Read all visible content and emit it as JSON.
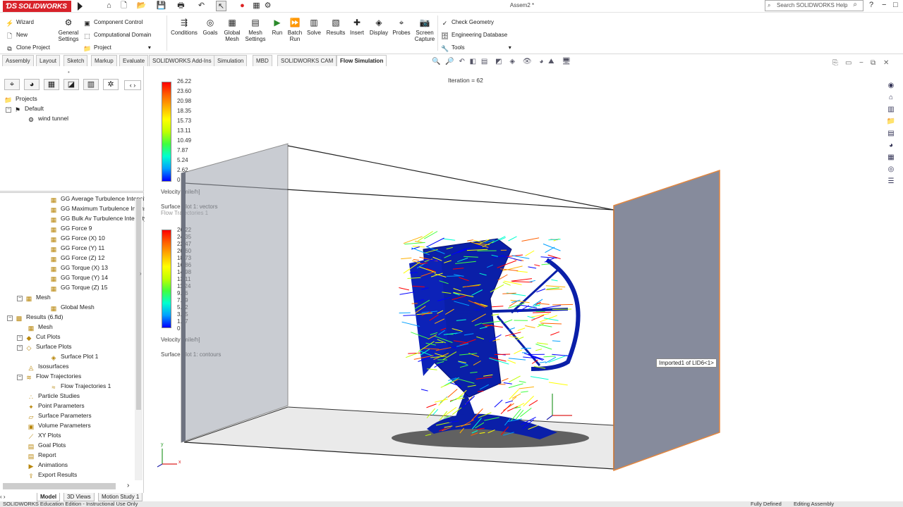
{
  "app": {
    "name": "SOLIDWORKS",
    "doc_title": "Assem2 *"
  },
  "search": {
    "placeholder": "Search SOLIDWORKS Help"
  },
  "ribbon": {
    "col1": [
      "Wizard",
      "New",
      "Clone Project"
    ],
    "general_settings": "General Settings",
    "col3": [
      "Component Control",
      "Computational Domain",
      "Project"
    ],
    "big": [
      "Conditions",
      "Goals",
      "Global Mesh",
      "Mesh Settings",
      "Run",
      "Batch Run",
      "Solve",
      "Results",
      "Insert",
      "Display",
      "Probes",
      "Screen Capture"
    ],
    "col_right": [
      "Check Geometry",
      "Engineering Database",
      "Tools"
    ]
  },
  "tabs": [
    "Assembly",
    "Layout",
    "Sketch",
    "Markup",
    "Evaluate",
    "SOLIDWORKS Add-Ins",
    "Simulation",
    "MBD",
    "SOLIDWORKS CAM",
    "Flow Simulation"
  ],
  "active_tab": "Flow Simulation",
  "tree_top": {
    "projects": "Projects",
    "default": "Default",
    "wind_tunnel": "wind tunnel"
  },
  "tree": [
    "GG Average Turbulence Intensity",
    "GG Maximum Turbulence Intens",
    "GG Bulk Av Turbulence Intensity",
    "GG Force 9",
    "GG Force (X) 10",
    "GG Force (Y) 11",
    "GG Force (Z) 12",
    "GG Torque (X) 13",
    "GG Torque (Y) 14",
    "GG Torque (Z) 15",
    "Mesh",
    "Global Mesh",
    "Results (6.fld)",
    "Mesh",
    "Cut Plots",
    "Surface Plots",
    "Surface Plot 1",
    "Isosurfaces",
    "Flow Trajectories",
    "Flow Trajectories 1",
    "Particle Studies",
    "Point Parameters",
    "Surface Parameters",
    "Volume Parameters",
    "XY Plots",
    "Goal Plots",
    "Report",
    "Animations",
    "Export Results"
  ],
  "bottom_tabs": [
    "Model",
    "3D Views",
    "Motion Study 1"
  ],
  "status": {
    "left": "SOLIDWORKS Education Edition - Instructional Use Only",
    "mid": "Fully Defined",
    "right": "Editing Assembly"
  },
  "viewport": {
    "iteration": "Iteration = 62",
    "legend1": {
      "ticks": [
        "26.22",
        "23.60",
        "20.98",
        "18.35",
        "15.73",
        "13.11",
        "10.49",
        "7.87",
        "5.24",
        "2.62",
        "0"
      ],
      "title": "Velocity [mile/h]",
      "plot1": "Surface Plot 1: vectors",
      "plot2": "Flow Trajectories 1"
    },
    "legend2": {
      "ticks": [
        "26.22",
        "24.35",
        "22.47",
        "20.60",
        "18.73",
        "16.86",
        "14.98",
        "13.11",
        "11.24",
        "9.36",
        "7.49",
        "5.62",
        "3.75",
        "1.87",
        "0"
      ],
      "title": "Velocity [mile/h]",
      "plot1": "Surface Plot 1: contours"
    },
    "tooltip": "Imported1 of LID6<1>",
    "axis": {
      "x": "x",
      "y": "y"
    }
  },
  "colors": {
    "accent": "#d8222a",
    "legend": [
      "#0000ff",
      "#00a0ff",
      "#00ffd0",
      "#40ff40",
      "#c0ff00",
      "#ffff00",
      "#ffb000",
      "#ff6000",
      "#ff0000"
    ]
  },
  "icons": [
    "home-icon",
    "new-document-icon",
    "open-icon",
    "save-icon",
    "print-icon",
    "undo-icon",
    "select-arrow-icon",
    "traffic-light-icon",
    "options-gear-icon",
    "search-icon",
    "help-icon"
  ]
}
